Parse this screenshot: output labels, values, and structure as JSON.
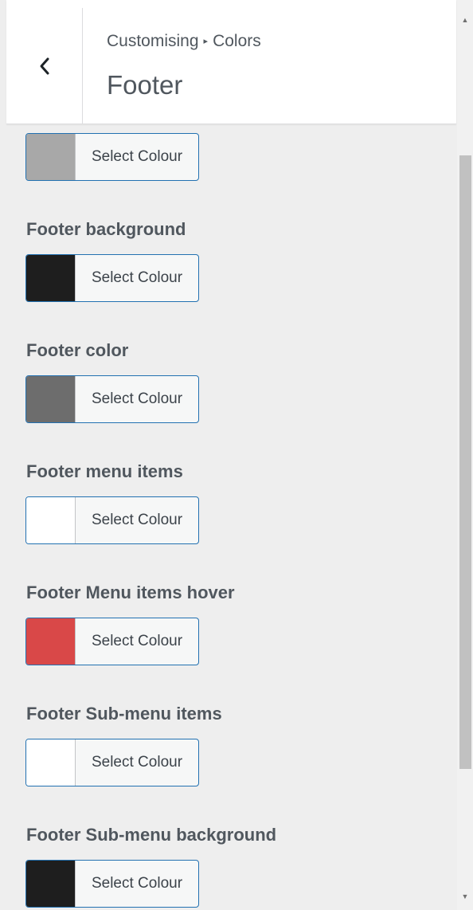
{
  "header": {
    "breadcrumb_root": "Customising",
    "breadcrumb_separator": "▸",
    "breadcrumb_panel": "Colors",
    "section_title": "Footer",
    "back_icon": "chevron-left-icon"
  },
  "controls": [
    {
      "label": "",
      "button_text": "Select Colour",
      "color": "#a8a8a8"
    },
    {
      "label": "Footer background",
      "button_text": "Select Colour",
      "color": "#1e1e1e"
    },
    {
      "label": "Footer color",
      "button_text": "Select Colour",
      "color": "#6d6d6d"
    },
    {
      "label": "Footer menu items",
      "button_text": "Select Colour",
      "color": "#ffffff"
    },
    {
      "label": "Footer Menu items hover",
      "button_text": "Select Colour",
      "color": "#d94848"
    },
    {
      "label": "Footer Sub-menu items",
      "button_text": "Select Colour",
      "color": "#ffffff"
    },
    {
      "label": "Footer Sub-menu background",
      "button_text": "Select Colour",
      "color": "#1e1e1e"
    }
  ],
  "colors": {
    "accent_border": "#2271b1",
    "panel_background": "#eeeeee"
  }
}
